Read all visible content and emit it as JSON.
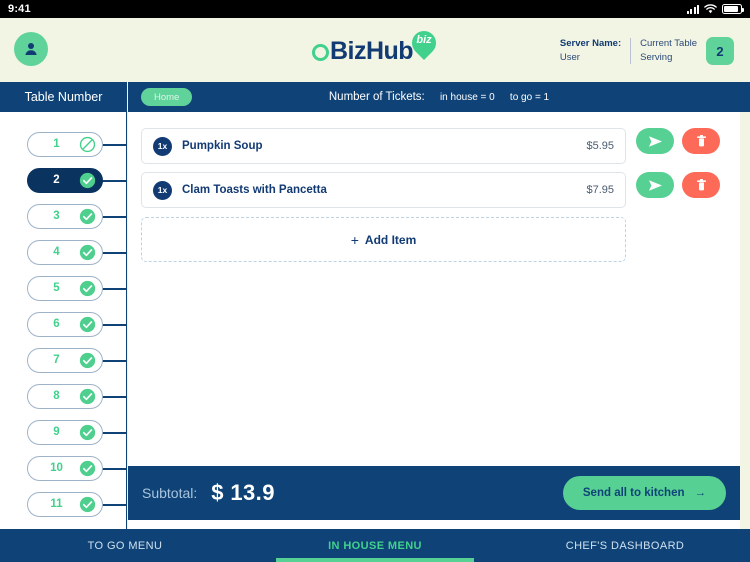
{
  "status_bar": {
    "time": "9:41",
    "icons": [
      "signal-icon",
      "wifi-icon",
      "battery-icon"
    ]
  },
  "header": {
    "avatar_icon": "user-avatar-icon",
    "logo": {
      "mark": "circle-o",
      "text": "BizHub",
      "pin_label": "biz"
    },
    "server_label": "Server Name:",
    "server_value": "User",
    "current_table_label": "Current Table",
    "current_table_sub": "Serving",
    "current_table_number": "2"
  },
  "sidebar": {
    "title": "Table Number",
    "tables": [
      {
        "number": "1",
        "status": "blocked",
        "selected": false
      },
      {
        "number": "2",
        "status": "available",
        "selected": true
      },
      {
        "number": "3",
        "status": "available",
        "selected": false
      },
      {
        "number": "4",
        "status": "available",
        "selected": false
      },
      {
        "number": "5",
        "status": "available",
        "selected": false
      },
      {
        "number": "6",
        "status": "available",
        "selected": false
      },
      {
        "number": "7",
        "status": "available",
        "selected": false
      },
      {
        "number": "8",
        "status": "available",
        "selected": false
      },
      {
        "number": "9",
        "status": "available",
        "selected": false
      },
      {
        "number": "10",
        "status": "available",
        "selected": false
      },
      {
        "number": "11",
        "status": "available",
        "selected": false
      }
    ]
  },
  "ticket_bar": {
    "home_pill": "Home",
    "tickets_label": "Number of Tickets:",
    "in_house": "in house = 0",
    "to_go": "to go = 1"
  },
  "order": {
    "items": [
      {
        "qty": "1x",
        "name": "Pumpkin Soup",
        "price": "$5.95"
      },
      {
        "qty": "1x",
        "name": "Clam Toasts with Pancetta",
        "price": "$7.95"
      }
    ],
    "add_item_label": "Add Item",
    "add_item_plus": "+",
    "row_actions": {
      "send_icon": "send-plane-icon",
      "delete_icon": "trash-icon"
    }
  },
  "footer": {
    "subtotal_label": "Subtotal:",
    "subtotal_value": "$ 13.9",
    "send_all_label": "Send all to kitchen",
    "send_all_arrow": "→"
  },
  "bottom_nav": {
    "tabs": [
      {
        "label": "TO GO MENU",
        "active": false
      },
      {
        "label": "IN HOUSE MENU",
        "active": true
      },
      {
        "label": "CHEF'S DASHBOARD",
        "active": false
      }
    ]
  },
  "colors": {
    "navy": "#0f4377",
    "navy_dark": "#0a3360",
    "green": "#56d193",
    "green_bright": "#41d18c",
    "red": "#fd6a58",
    "cream": "#f2f5e3"
  }
}
